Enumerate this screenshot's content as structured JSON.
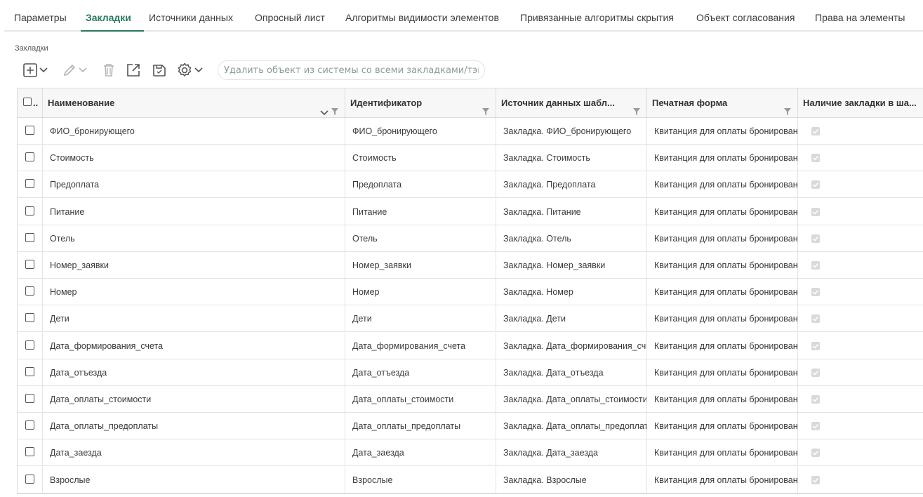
{
  "tabs": [
    {
      "label": "Параметры",
      "active": false
    },
    {
      "label": "Закладки",
      "active": true
    },
    {
      "label": "Источники данных",
      "active": false
    },
    {
      "label": "Опросный лист",
      "active": false
    },
    {
      "label": "Алгоритмы видимости элементов",
      "active": false
    },
    {
      "label": "Привязанные алгоритмы скрытия",
      "active": false
    },
    {
      "label": "Объект согласования",
      "active": false
    },
    {
      "label": "Права на элементы",
      "active": false
    }
  ],
  "section_label": "Закладки",
  "toolbar": {
    "icons": [
      "add-icon",
      "edit-icon",
      "delete-icon",
      "open-external-icon",
      "save-icon",
      "settings-icon"
    ],
    "search_placeholder": "Удалить объект из системы со всеми закладками/тэгами"
  },
  "grid": {
    "select_all_label": "..",
    "columns": [
      "Наименование",
      "Идентификатор",
      "Источник данных шабл...",
      "Печатная форма",
      "Наличие закладки в ша..."
    ],
    "rows": [
      {
        "name": "ФИО_бронирующего",
        "id": "ФИО_бронирующего",
        "source": "Закладка. ФИО_бронирующего",
        "form": "Квитанция для оплаты бронирован",
        "has": true
      },
      {
        "name": "Стоимость",
        "id": "Стоимость",
        "source": "Закладка. Стоимость",
        "form": "Квитанция для оплаты бронирован",
        "has": true
      },
      {
        "name": "Предоплата",
        "id": "Предоплата",
        "source": "Закладка. Предоплата",
        "form": "Квитанция для оплаты бронирован",
        "has": true
      },
      {
        "name": "Питание",
        "id": "Питание",
        "source": "Закладка. Питание",
        "form": "Квитанция для оплаты бронирован",
        "has": true
      },
      {
        "name": "Отель",
        "id": "Отель",
        "source": "Закладка. Отель",
        "form": "Квитанция для оплаты бронирован",
        "has": true
      },
      {
        "name": "Номер_заявки",
        "id": "Номер_заявки",
        "source": "Закладка. Номер_заявки",
        "form": "Квитанция для оплаты бронирован",
        "has": true
      },
      {
        "name": "Номер",
        "id": "Номер",
        "source": "Закладка. Номер",
        "form": "Квитанция для оплаты бронирован",
        "has": true
      },
      {
        "name": "Дети",
        "id": "Дети",
        "source": "Закладка. Дети",
        "form": "Квитанция для оплаты бронирован",
        "has": true
      },
      {
        "name": "Дата_формирования_счета",
        "id": "Дата_формирования_счета",
        "source": "Закладка. Дата_формирования_сче",
        "form": "Квитанция для оплаты бронирован",
        "has": true
      },
      {
        "name": "Дата_отъезда",
        "id": "Дата_отъезда",
        "source": "Закладка. Дата_отъезда",
        "form": "Квитанция для оплаты бронирован",
        "has": true
      },
      {
        "name": "Дата_оплаты_стоимости",
        "id": "Дата_оплаты_стоимости",
        "source": "Закладка. Дата_оплаты_стоимости",
        "form": "Квитанция для оплаты бронирован",
        "has": true
      },
      {
        "name": "Дата_оплаты_предоплаты",
        "id": "Дата_оплаты_предоплаты",
        "source": "Закладка. Дата_оплаты_предоплаты",
        "form": "Квитанция для оплаты бронирован",
        "has": true
      },
      {
        "name": "Дата_заезда",
        "id": "Дата_заезда",
        "source": "Закладка. Дата_заезда",
        "form": "Квитанция для оплаты бронирован",
        "has": true
      },
      {
        "name": "Взрослые",
        "id": "Взрослые",
        "source": "Закладка. Взрослые",
        "form": "Квитанция для оплаты бронирован",
        "has": true
      }
    ]
  },
  "colors": {
    "accent": "#2b7a5e",
    "icon": "#5a5a5a",
    "icon_disabled": "#b5b5b5"
  }
}
